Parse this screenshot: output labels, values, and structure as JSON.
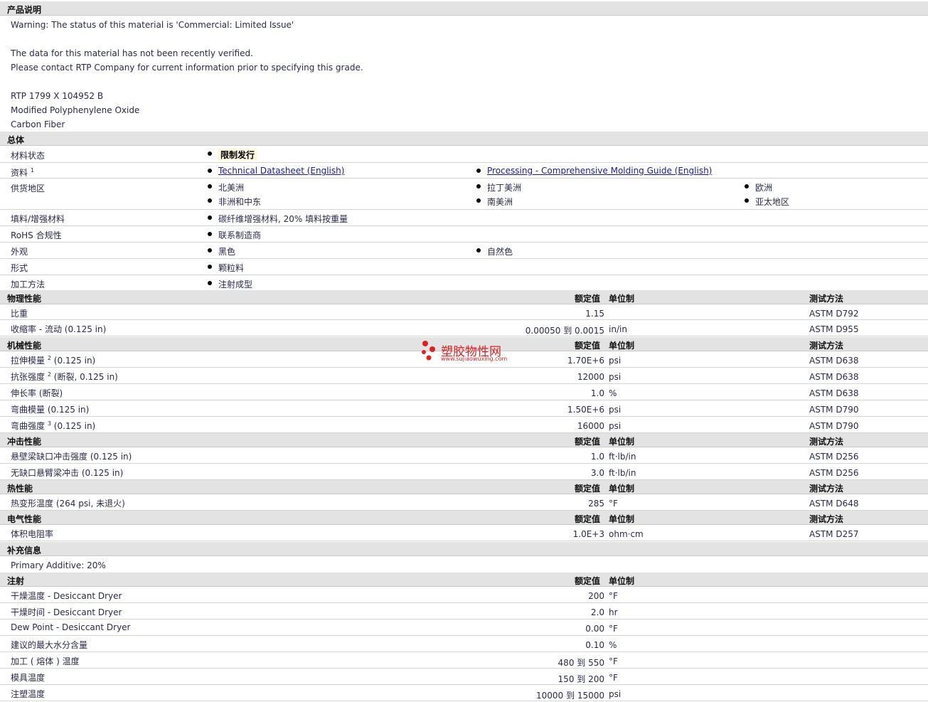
{
  "sections": {
    "desc": "产品说明",
    "general": "总体",
    "physical": "物理性能",
    "mechanical": "机械性能",
    "impact": "冲击性能",
    "thermal": "热性能",
    "electrical": "电气性能",
    "additional": "补充信息",
    "injection": "注射"
  },
  "col_headers": {
    "nominal": "额定值",
    "unit": "单位制",
    "test": "测试方法"
  },
  "desc_lines": [
    "Warning: The status of this material is 'Commercial: Limited Issue'",
    "The data for this material has not been recently verified.",
    "Please contact RTP Company for current information prior to specifying this grade.",
    "RTP 1799 X 104952 B",
    "Modified Polyphenylene Oxide",
    "Carbon Fiber"
  ],
  "general": {
    "status_label": "材料状态",
    "status_value": "限制发行",
    "docs_label": "资料",
    "docs_sup": "1",
    "docs": [
      "Technical Datasheet (English)",
      "Processing - Comprehensive Molding Guide (English)"
    ],
    "regions_label": "供货地区",
    "regions": [
      "北美洲",
      "拉丁美洲",
      "欧洲",
      "非洲和中东",
      "南美洲",
      "亚太地区"
    ],
    "filler_label": "填料/增强材料",
    "filler_value": "碳纤维增强材料, 20% 填料按重量",
    "rohs_label": "RoHS 合规性",
    "rohs_value": "联系制造商",
    "appearance_label": "外观",
    "appearance": [
      "黑色",
      "自然色"
    ],
    "form_label": "形式",
    "form_value": "颗粒料",
    "method_label": "加工方法",
    "method_value": "注射成型"
  },
  "physical": [
    {
      "name": "比重",
      "cond": "",
      "sup": "",
      "value": "1.15",
      "unit": "",
      "test": "ASTM D792"
    },
    {
      "name": "收缩率 - 流动",
      "cond": "(0.125 in)",
      "sup": "",
      "value": "0.00050 到  0.0015",
      "unit": "in/in",
      "test": "ASTM D955"
    }
  ],
  "mechanical": [
    {
      "name": "拉伸模量",
      "cond": "(0.125 in)",
      "sup": "2",
      "value": "1.70E+6",
      "unit": "psi",
      "test": "ASTM D638"
    },
    {
      "name": "抗张强度",
      "cond": "(断裂, 0.125 in)",
      "sup": "2",
      "value": "12000",
      "unit": "psi",
      "test": "ASTM D638"
    },
    {
      "name": "伸长率",
      "cond": "(断裂)",
      "sup": "",
      "value": "1.0",
      "unit": "%",
      "test": "ASTM D638"
    },
    {
      "name": "弯曲模量",
      "cond": "(0.125 in)",
      "sup": "",
      "value": "1.50E+6",
      "unit": "psi",
      "test": "ASTM D790"
    },
    {
      "name": "弯曲强度",
      "cond": "(0.125 in)",
      "sup": "3",
      "value": "16000",
      "unit": "psi",
      "test": "ASTM D790"
    }
  ],
  "impact": [
    {
      "name": "悬壁梁缺口冲击强度",
      "cond": "(0.125 in)",
      "sup": "",
      "value": "1.0",
      "unit": "ft·lb/in",
      "test": "ASTM D256"
    },
    {
      "name": "无缺口悬臂梁冲击",
      "cond": "(0.125 in)",
      "sup": "",
      "value": "3.0",
      "unit": "ft·lb/in",
      "test": "ASTM D256"
    }
  ],
  "thermal": [
    {
      "name": "热变形温度",
      "cond": "(264 psi, 未退火)",
      "sup": "",
      "value": "285",
      "unit": "°F",
      "test": "ASTM D648"
    }
  ],
  "electrical": [
    {
      "name": "体积电阻率",
      "cond": "",
      "sup": "",
      "value": "1.0E+3",
      "unit": "ohm·cm",
      "test": "ASTM D257"
    }
  ],
  "additional_note": "Primary Additive: 20%",
  "injection": [
    {
      "name": "干燥温度 - Desiccant Dryer",
      "value": "200",
      "unit": "°F"
    },
    {
      "name": "干燥时间 - Desiccant Dryer",
      "value": "2.0",
      "unit": "hr"
    },
    {
      "name": "Dew Point - Desiccant Dryer",
      "value": "0.00",
      "unit": "°F"
    },
    {
      "name": "建议的最大水分含量",
      "value": "0.10",
      "unit": "%"
    },
    {
      "name": "加工 ( 熔体 ) 温度",
      "value": "480 到  550",
      "unit": "°F"
    },
    {
      "name": "模具温度",
      "value": "150 到  200",
      "unit": "°F"
    },
    {
      "name": "注塑温度",
      "value": "10000 到  15000",
      "unit": "psi"
    }
  ],
  "watermark": {
    "title": "塑胶物性网",
    "url": "www.sujiaowuxing.com",
    "color": "#e02020"
  }
}
